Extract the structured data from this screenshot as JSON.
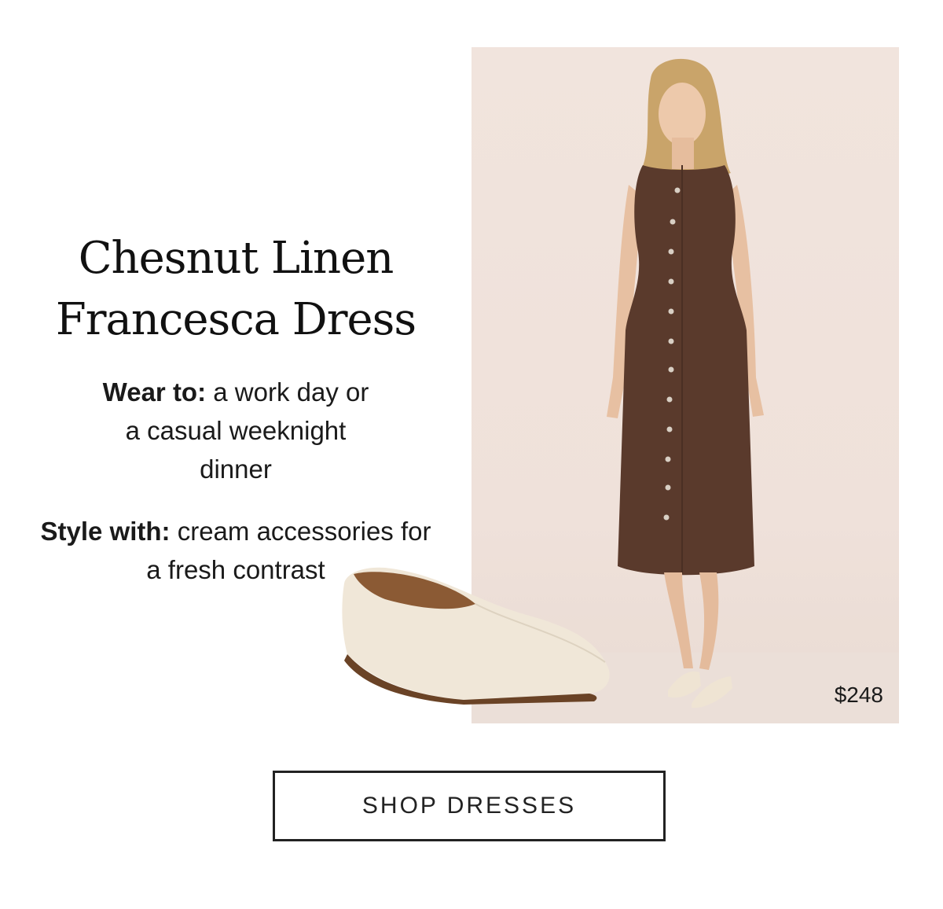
{
  "product": {
    "title_line1": "Chesnut Linen",
    "title_line2": "Francesca Dress",
    "wear_label": "Wear to:",
    "wear_text": " a work day or a casual weeknight dinner",
    "style_label": "Style with:",
    "style_text": " cream accessories for a fresh contrast",
    "price": "$248"
  },
  "cta": {
    "label": "SHOP DRESSES"
  },
  "colors": {
    "dress": "#5a3a2c",
    "background_photo": "#efe1da",
    "shoe": "#efe6d6"
  }
}
